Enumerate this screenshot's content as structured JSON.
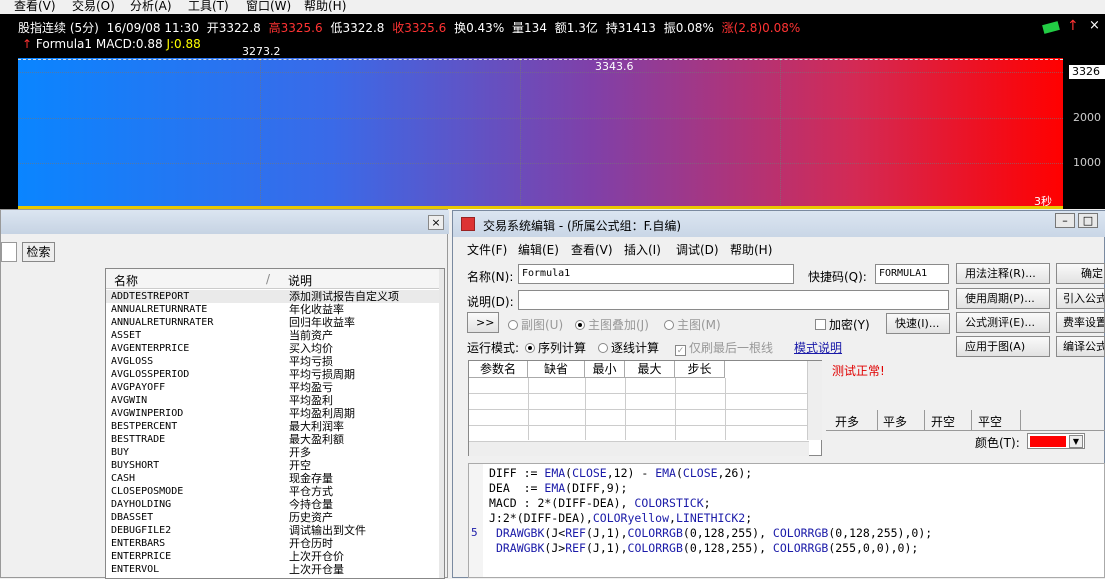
{
  "menubar": {
    "items": [
      "查看(V)",
      "交易(O)",
      "分析(A)",
      "工具(T)",
      "窗口(W)",
      "帮助(H)"
    ]
  },
  "chart": {
    "header": {
      "title": "股指连续 (5分)",
      "datetime": "16/09/08 11:30",
      "open": "开3322.8",
      "high": "高3325.6",
      "low": "低3322.8",
      "close": "收3325.6",
      "turnover": "换0.43%",
      "volume": "量134",
      "amount": "额1.3亿",
      "hold": "持31413",
      "amplitude": "振0.08%",
      "change": "涨(2.8)0.08%"
    },
    "formula_line": {
      "name": "Formula1",
      "macd": "MACD:0.88",
      "j": "J:0.88"
    },
    "price_labels": [
      "3273.2",
      "3343.6"
    ],
    "yaxis": {
      "current": "3326",
      "ticks": [
        "2000",
        "1000"
      ]
    },
    "timer": "3秒",
    "colors": {
      "up": "#ff3333",
      "down": "#00cc66",
      "j": "#ffff00"
    }
  },
  "left_panel": {
    "search_label": "检索",
    "columns": [
      "名称",
      "说明"
    ],
    "rows": [
      {
        "name": "ADDTESTREPORT",
        "desc": "添加测试报告自定义项"
      },
      {
        "name": "ANNUALRETURNRATE",
        "desc": "年化收益率"
      },
      {
        "name": "ANNUALRETURNRATER",
        "desc": "回归年收益率"
      },
      {
        "name": "ASSET",
        "desc": "当前资产"
      },
      {
        "name": "AVGENTERPRICE",
        "desc": "买入均价"
      },
      {
        "name": "AVGLOSS",
        "desc": "平均亏损"
      },
      {
        "name": "AVGLOSSPERIOD",
        "desc": "平均亏损周期"
      },
      {
        "name": "AVGPAYOFF",
        "desc": "平均盈亏"
      },
      {
        "name": "AVGWIN",
        "desc": "平均盈利"
      },
      {
        "name": "AVGWINPERIOD",
        "desc": "平均盈利周期"
      },
      {
        "name": "BESTPERCENT",
        "desc": "最大利润率"
      },
      {
        "name": "BESTTRADE",
        "desc": "最大盈利额"
      },
      {
        "name": "BUY",
        "desc": "开多"
      },
      {
        "name": "BUYSHORT",
        "desc": "开空"
      },
      {
        "name": "CASH",
        "desc": "现金存量"
      },
      {
        "name": "CLOSEPOSMODE",
        "desc": "平仓方式"
      },
      {
        "name": "DAYHOLDING",
        "desc": "今持仓量"
      },
      {
        "name": "DBASSET",
        "desc": "历史资产"
      },
      {
        "name": "DEBUGFILE2",
        "desc": "调试输出到文件"
      },
      {
        "name": "ENTERBARS",
        "desc": "开仓历时"
      },
      {
        "name": "ENTERPRICE",
        "desc": "上次开仓价"
      },
      {
        "name": "ENTERVOL",
        "desc": "上次开仓量"
      }
    ]
  },
  "editor": {
    "title": "交易系统编辑 - (所属公式组：F.自编)",
    "menu": [
      "文件(F)",
      "编辑(E)",
      "查看(V)",
      "插入(I)",
      "调试(D)",
      "帮助(H)"
    ],
    "name_label": "名称(N):",
    "name_value": "Formula1",
    "shortcut_label": "快捷码(Q):",
    "shortcut_value": "FORMULA1",
    "desc_label": "说明(D):",
    "desc_value": "",
    "expand_label": ">>",
    "layer_options": [
      "副图(U)",
      "主图叠加(J)",
      "主图(M)"
    ],
    "encrypt_label": "加密(Y)",
    "fast_label": "快速(I)...",
    "run_mode_label": "运行模式:",
    "run_modes": [
      "序列计算",
      "逐线计算"
    ],
    "last_bar_label": "仅刷最后一根线",
    "mode_link": "模式说明",
    "status": "测试正常!",
    "param_headers": [
      "参数名",
      "缺省",
      "最小",
      "最大",
      "步长"
    ],
    "right_buttons_col1": [
      "用法注释(R)...",
      "使用周期(P)...",
      "公式测评(E)...",
      "应用于图(A)"
    ],
    "right_buttons_col2": [
      "确定",
      "引入公式",
      "费率设置",
      "编译公式"
    ],
    "tabs": [
      "开多",
      "平多",
      "开空",
      "平空"
    ],
    "color_label": "颜色(T):",
    "color_value": "#ff0000",
    "line_number": "5",
    "code": [
      "DIFF := EMA(CLOSE,12) - EMA(CLOSE,26);",
      "DEA  := EMA(DIFF,9);",
      "MACD : 2*(DIFF-DEA), COLORSTICK;",
      "J:2*(DIFF-DEA),COLORyellow,LINETHICK2;",
      " DRAWGBK(J<REF(J,1),COLORRGB(0,128,255), COLORRGB(0,128,255),0);",
      " DRAWGBK(J>REF(J,1),COLORRGB(0,128,255), COLORRGB(255,0,0),0);"
    ]
  }
}
